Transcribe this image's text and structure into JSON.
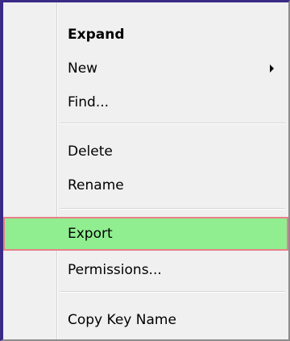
{
  "menu": {
    "items": [
      {
        "label": "Expand"
      },
      {
        "label": "New"
      },
      {
        "label": "Find..."
      },
      {
        "label": "Delete"
      },
      {
        "label": "Rename"
      },
      {
        "label": "Export"
      },
      {
        "label": "Permissions..."
      },
      {
        "label": "Copy Key Name"
      }
    ],
    "highlight_color": "#90ee90",
    "highlight_border_color": "#e8808a",
    "submenu_arrow_icon": "chevron-right-icon"
  }
}
